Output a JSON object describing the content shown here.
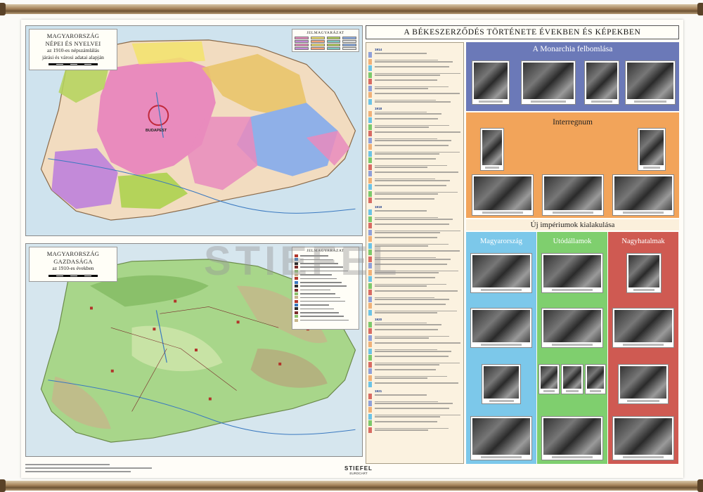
{
  "poster": {
    "main_title": "A BÉKESZERZŐDÉS TÖRTÉNETE ÉVEKBEN ÉS KÉPEKBEN",
    "watermark": "STIEFEL",
    "footer_logo": "STIEFEL",
    "footer_logo_sub": "EUROCART"
  },
  "map1": {
    "title_line1": "MAGYARORSZÁG",
    "title_line2": "NÉPEI ÉS NYELVEI",
    "title_line3": "az 1910-es népszámlálás",
    "title_line4": "járási és városi adatai alapján",
    "legend_title": "JELMAGYARÁZAT",
    "legend_colors": [
      "#e98bbd",
      "#f3e36b",
      "#b4d35a",
      "#8fb0e8",
      "#c38ad9",
      "#f5a37a",
      "#7ac7c0",
      "#e1e1e1",
      "#e98bbd",
      "#f3e36b",
      "#b4d35a",
      "#8fb0e8",
      "#c38ad9",
      "#f5a37a",
      "#7ac7c0",
      "#e1e1e1"
    ],
    "city": "BUDAPEST"
  },
  "map2": {
    "title_line1": "MAGYARORSZÁG",
    "title_line2": "GAZDASÁGA",
    "title_line3": "az 1910-es években",
    "legend_title": "JELMAGYARÁZAT"
  },
  "timeline": {
    "years": [
      "1914",
      "1918",
      "1919",
      "1920",
      "1921"
    ],
    "marker_colors": [
      "#8fa0d8",
      "#f0b178",
      "#6cc3e6",
      "#7cc96b",
      "#d86b63"
    ]
  },
  "sections": {
    "monarchia": "A Monarchia felbomlása",
    "interregnum": "Interregnum",
    "uj_imperiumok": "Új impériumok kialakulása",
    "magyarorszag": "Magyarország",
    "utodallamok": "Utódállamok",
    "nagyhatalmak": "Nagyhatalmak"
  },
  "colors": {
    "monarchia": "#6b79b8",
    "interregnum": "#f2a45a",
    "magyarorszag": "#7cc8ea",
    "utodallamok": "#7fcf6e",
    "nagyhatalmak": "#cf5a52"
  }
}
